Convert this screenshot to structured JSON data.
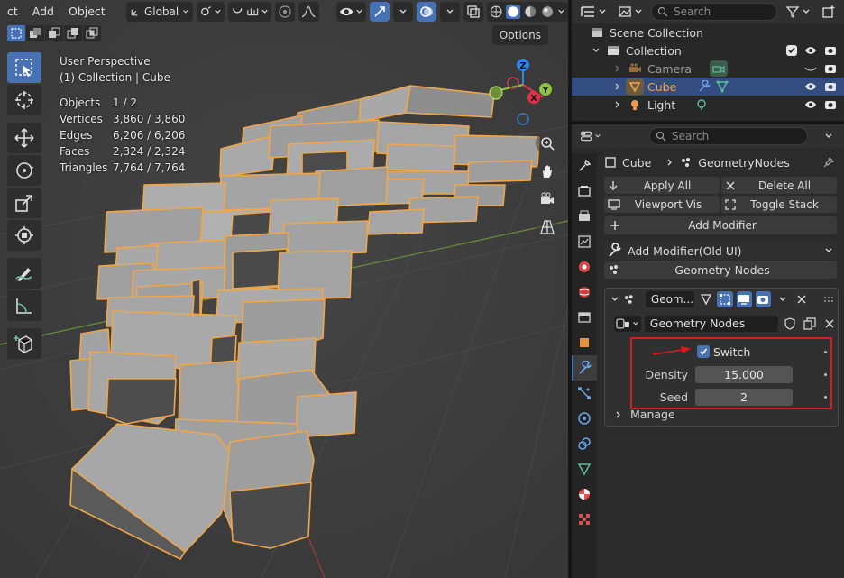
{
  "viewport": {
    "menu": [
      "ct",
      "Add",
      "Object"
    ],
    "transform_orientation": "Global",
    "options_label": "Options",
    "view_name": "User Perspective",
    "collection_line": "(1) Collection | Cube",
    "stats": [
      {
        "label": "Objects",
        "value": "1 / 2"
      },
      {
        "label": "Vertices",
        "value": "3,860 / 3,860"
      },
      {
        "label": "Edges",
        "value": "6,206 / 6,206"
      },
      {
        "label": "Faces",
        "value": "2,324 / 2,324"
      },
      {
        "label": "Triangles",
        "value": "7,764 / 7,764"
      }
    ],
    "gizmo": {
      "z": "Z",
      "y": "Y",
      "x": "X"
    }
  },
  "outliner": {
    "search_placeholder": "Search",
    "scene_collection": "Scene Collection",
    "collection": "Collection",
    "items": [
      {
        "name": "Camera"
      },
      {
        "name": "Cube"
      },
      {
        "name": "Light"
      }
    ]
  },
  "properties": {
    "search_placeholder": "Search",
    "breadcrumb_object": "Cube",
    "breadcrumb_modifier": "GeometryNodes",
    "apply_all": "Apply All",
    "delete_all": "Delete All",
    "viewport_vis": "Viewport Vis",
    "toggle_stack": "Toggle Stack",
    "add_modifier": "Add Modifier",
    "add_modifier_old": "Add Modifier(Old UI)",
    "geometry_nodes_btn": "Geometry Nodes",
    "modifier": {
      "name": "Geom...",
      "node_group": "Geometry Nodes",
      "switch_label": "Switch",
      "density_label": "Density",
      "density_value": "15.000",
      "seed_label": "Seed",
      "seed_value": "2",
      "manage_label": "Manage"
    }
  },
  "colors": {
    "selection_orange": "#f3a64b",
    "active_blue": "#4772b3",
    "highlight_red": "#d21f1f",
    "x_axis": "#e0334a",
    "y_axis": "#8ac53b",
    "z_axis": "#2e88e0"
  }
}
